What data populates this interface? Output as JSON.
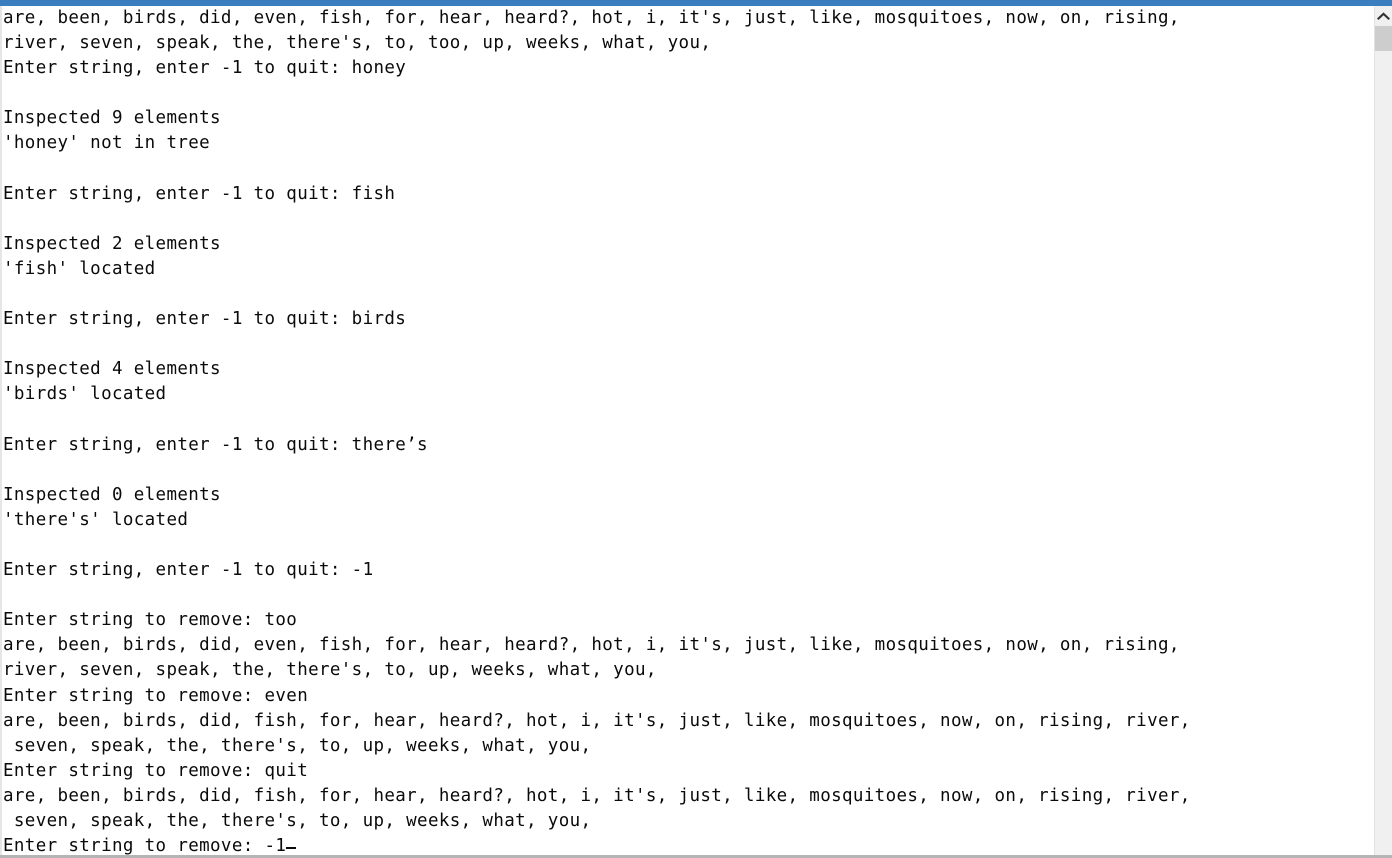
{
  "window": {
    "accent_color": "#3a7ebf",
    "background_color": "#ffffff",
    "text_color": "#0a0a0a"
  },
  "scrollbar": {
    "up_arrow_icon": "chevron-up-icon",
    "thumb_label": ""
  },
  "console": {
    "lines": [
      "are, been, birds, did, even, fish, for, hear, heard?, hot, i, it's, just, like, mosquitoes, now, on, rising,",
      "river, seven, speak, the, there's, to, too, up, weeks, what, you,",
      "Enter string, enter -1 to quit: honey",
      "",
      "Inspected 9 elements",
      "'honey' not in tree",
      "",
      "Enter string, enter -1 to quit: fish",
      "",
      "Inspected 2 elements",
      "'fish' located",
      "",
      "Enter string, enter -1 to quit: birds",
      "",
      "Inspected 4 elements",
      "'birds' located",
      "",
      "Enter string, enter -1 to quit: there’s",
      "",
      "Inspected 0 elements",
      "'there's' located",
      "",
      "Enter string, enter -1 to quit: -1",
      "",
      "Enter string to remove: too",
      "are, been, birds, did, even, fish, for, hear, heard?, hot, i, it's, just, like, mosquitoes, now, on, rising,",
      "river, seven, speak, the, there's, to, up, weeks, what, you,",
      "Enter string to remove: even",
      "are, been, birds, did, fish, for, hear, heard?, hot, i, it's, just, like, mosquitoes, now, on, rising, river,",
      " seven, speak, the, there's, to, up, weeks, what, you,",
      "Enter string to remove: quit",
      "are, been, birds, did, fish, for, hear, heard?, hot, i, it's, just, like, mosquitoes, now, on, rising, river,",
      " seven, speak, the, there's, to, up, weeks, what, you,",
      "Enter string to remove: -1"
    ],
    "cursor_visible": true
  }
}
